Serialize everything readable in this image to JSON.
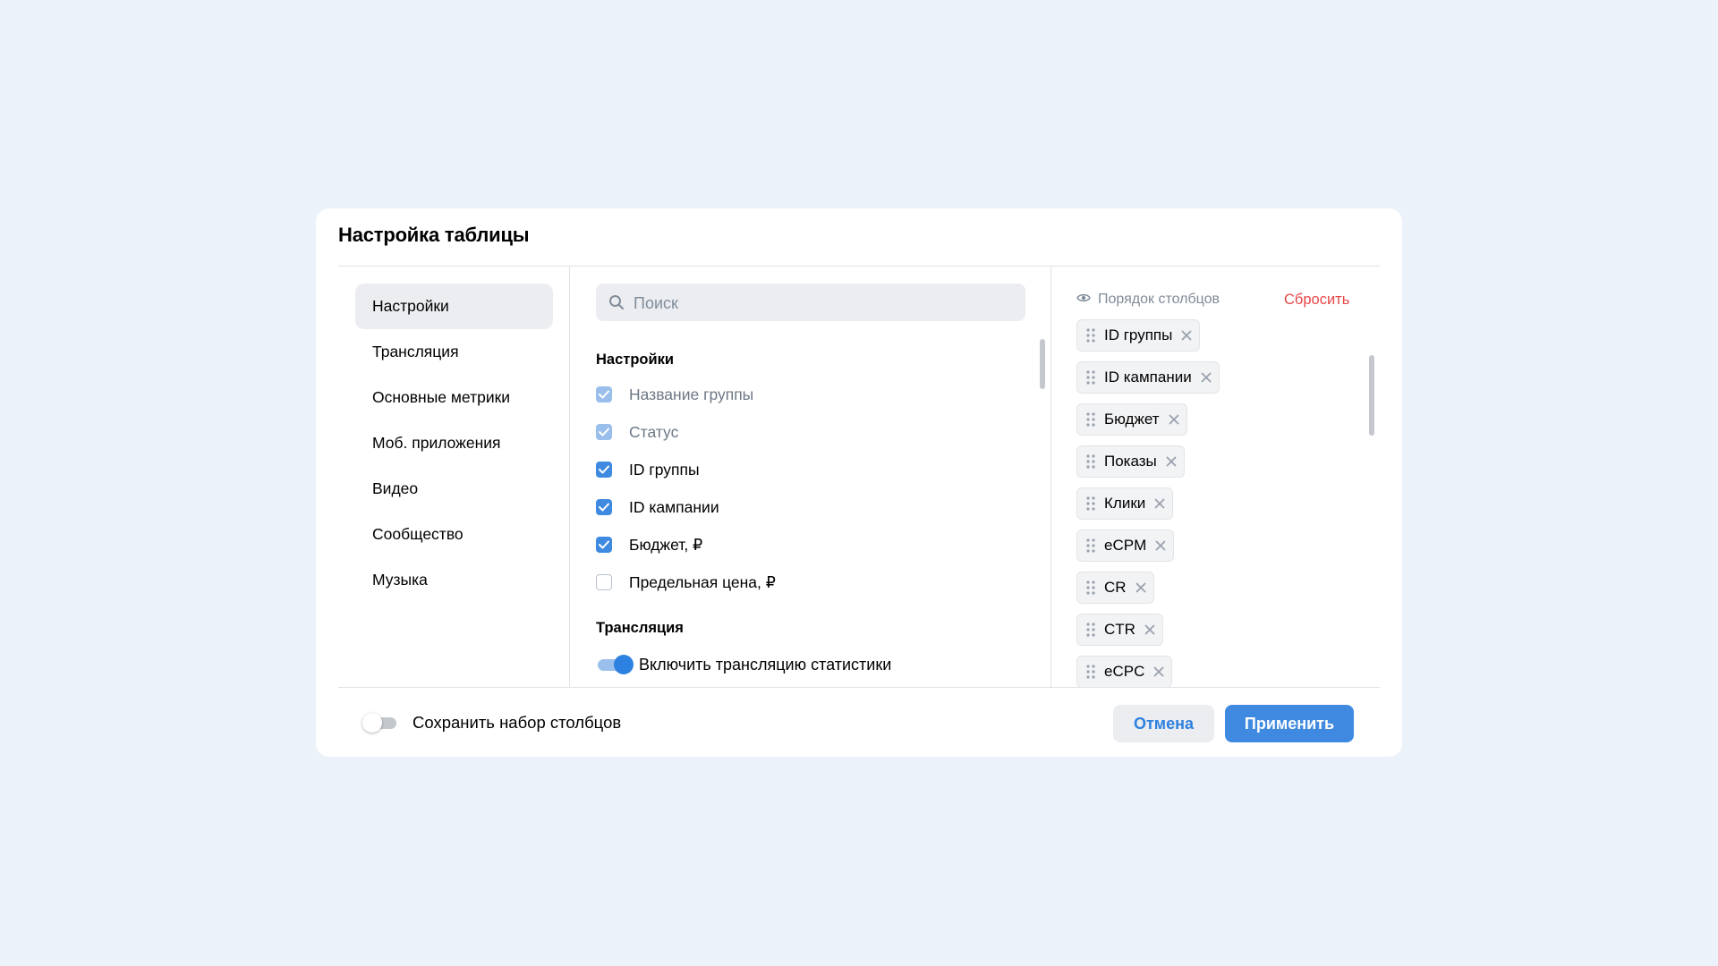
{
  "modal": {
    "title": "Настройка таблицы"
  },
  "nav": {
    "items": [
      {
        "label": "Настройки",
        "active": true
      },
      {
        "label": "Трансляция"
      },
      {
        "label": "Основные метрики"
      },
      {
        "label": "Моб. приложения"
      },
      {
        "label": "Видео"
      },
      {
        "label": "Сообщество"
      },
      {
        "label": "Музыка"
      }
    ]
  },
  "search": {
    "placeholder": "Поиск",
    "value": ""
  },
  "settings_section": {
    "title": "Настройки",
    "items": [
      {
        "label": "Название группы",
        "checked": true,
        "disabled": true
      },
      {
        "label": "Статус",
        "checked": true,
        "disabled": true
      },
      {
        "label": "ID группы",
        "checked": true
      },
      {
        "label": "ID кампании",
        "checked": true
      },
      {
        "label": "Бюджет, ₽",
        "checked": true
      },
      {
        "label": "Предельная цена, ₽",
        "checked": false
      }
    ]
  },
  "broadcast_section": {
    "title": "Трансляция",
    "toggle_label": "Включить трансляцию статистики",
    "toggle_on": true
  },
  "column_order": {
    "title": "Порядок столбцов",
    "reset_label": "Сбросить",
    "columns": [
      "ID группы",
      "ID кампании",
      "Бюджет",
      "Показы",
      "Клики",
      "eCPM",
      "CR",
      "CTR",
      "eCPC"
    ]
  },
  "footer": {
    "save_set_label": "Сохранить набор столбцов",
    "save_set_on": false,
    "cancel_label": "Отмена",
    "apply_label": "Применить"
  },
  "colors": {
    "background": "#ebf2f9",
    "accent": "#3f8ae0",
    "danger": "#e64646",
    "muted_text": "#818c99"
  },
  "icons": [
    "search-icon",
    "eye-icon",
    "drag-handle-icon",
    "close-icon",
    "checkmark-icon"
  ]
}
